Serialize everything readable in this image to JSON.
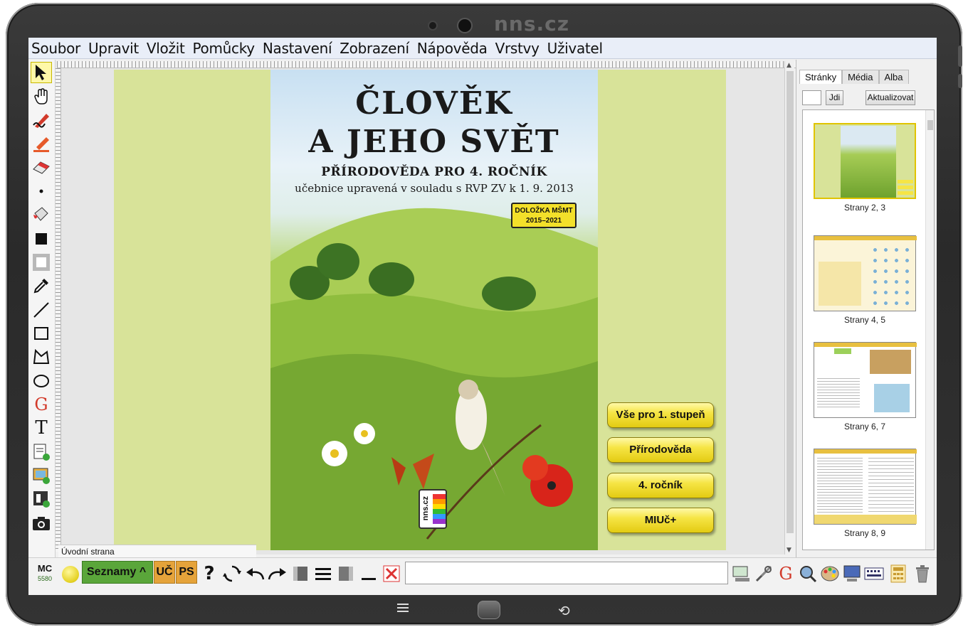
{
  "device": {
    "brand_text": "nns.cz"
  },
  "menubar": {
    "items": [
      "Soubor",
      "Upravit",
      "Vložit",
      "Pomůcky",
      "Nastavení",
      "Zobrazení",
      "Nápověda",
      "Vrstvy",
      "Uživatel"
    ]
  },
  "cover": {
    "title_line1": "ČLOVĚK",
    "title_line2": "A JEHO SVĚT",
    "subtitle": "PŘÍRODOVĚDA PRO 4. ROČNÍK",
    "note": "učebnice upravená v souladu s RVP ZV k 1. 9. 2013",
    "badge_line1": "DOLOŽKA MŠMT",
    "badge_line2": "2015–2021",
    "logo_text": "nns.cz"
  },
  "cover_buttons": [
    "Vše pro 1. stupeň",
    "Přírodověda",
    "4. ročník",
    "MIUč+"
  ],
  "status": {
    "page_name": "Úvodní strana"
  },
  "rightpanel": {
    "tabs": [
      "Stránky",
      "Média",
      "Alba"
    ],
    "go_label": "Jdi",
    "refresh_label": "Aktualizovat",
    "thumbnails": [
      "Strany 2, 3",
      "Strany 4, 5",
      "Strany 6, 7",
      "Strany 8, 9"
    ]
  },
  "bottombar": {
    "mc_label": "MC",
    "mc_number": "5580",
    "seznamy_label": "Seznamy ^",
    "uc_label": "UČ",
    "ps_label": "PS",
    "help_label": "?"
  },
  "colors": {
    "page_background": "#d8e399",
    "menubar_bg": "#e9eef8",
    "button_yellow": "#f6e545",
    "seznamy_green": "#5aa63a",
    "tab_orange": "#e5a33a"
  }
}
